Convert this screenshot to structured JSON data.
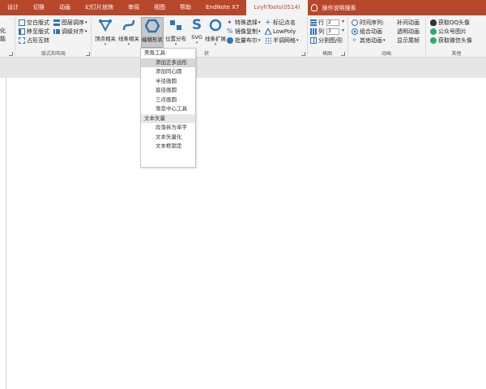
{
  "tabs": [
    {
      "label": "设计",
      "active": false
    },
    {
      "label": "切换",
      "active": false
    },
    {
      "label": "动画",
      "active": false
    },
    {
      "label": "幻灯片放映",
      "active": false
    },
    {
      "label": "审阅",
      "active": false
    },
    {
      "label": "视图",
      "active": false
    },
    {
      "label": "帮助",
      "active": false
    },
    {
      "label": "EndNote X7",
      "active": false
    },
    {
      "label": "LvyhTools(0514)",
      "active": true
    }
  ],
  "tell_me": "操作说明搜索",
  "ribbon": {
    "left_clip": {
      "row1": "化",
      "row2": "能"
    },
    "layout_group": {
      "label": "版式和布局",
      "items": [
        "空白版式",
        "移至版式",
        "占形互转",
        "图层调序",
        "调级对齐"
      ]
    },
    "big_buttons": [
      {
        "label": "顶点相关"
      },
      {
        "label": "线条相关"
      },
      {
        "label": "编辑形状"
      },
      {
        "label": "位置分布"
      },
      {
        "label": "SVG"
      },
      {
        "label": "线条扩展"
      }
    ],
    "effects_group": {
      "items": [
        "特殊选择",
        "镜像复制",
        "批量布尔",
        "标记点名",
        "LowPoly",
        "半调网格"
      ],
      "label_tail": "状"
    },
    "table_group": {
      "label": "格图",
      "row_label": "行",
      "row_value": "2",
      "col_label": "列",
      "col_value": "3",
      "split_label": "分割图/形"
    },
    "animation_group": {
      "label": "动画",
      "items": [
        "时间序列:",
        "组合动画",
        "其他动画",
        "补间动画",
        "透明动画",
        "显示尾帧"
      ]
    },
    "other_group": {
      "label": "其他",
      "items": [
        "获取QQ头像",
        "公众号图片",
        "获取微信头像"
      ]
    }
  },
  "dropdown": {
    "items": [
      {
        "label": "美角工具:",
        "type": "first"
      },
      {
        "label": "添加正多边形",
        "type": "hover"
      },
      {
        "label": "添加同心圆",
        "type": "item"
      },
      {
        "label": "半径画圆",
        "type": "item"
      },
      {
        "label": "直径画圆",
        "type": "item"
      },
      {
        "label": "三点画圆",
        "type": "item"
      },
      {
        "label": "渐变中心工具",
        "type": "item"
      },
      {
        "label": "文本矢量",
        "type": "header"
      },
      {
        "label": "段落拆为单字",
        "type": "item"
      },
      {
        "label": "文本矢量化",
        "type": "item"
      },
      {
        "label": "文本框锁定",
        "type": "item"
      }
    ]
  },
  "colors": {
    "accent": "#b7472a",
    "ribbon_bg": "#f3f3f3",
    "icon_blue": "#2e75b6"
  }
}
